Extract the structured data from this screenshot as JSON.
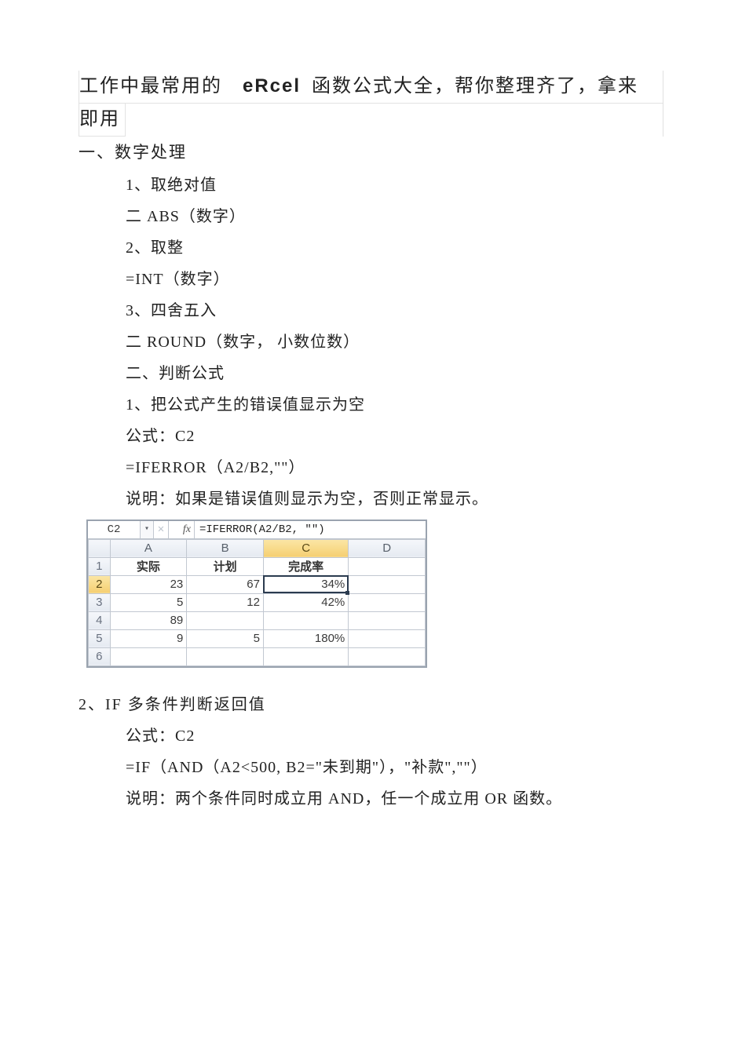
{
  "title": {
    "seg1": "工作中最常用的",
    "seg_eRcel": "eRcel",
    "seg2": "函数公式大全，帮你整理齐了，拿来",
    "line2": "即用"
  },
  "section1": {
    "heading": "一、数字处理",
    "lines": [
      "1、取绝对值",
      "二 ABS（数字）",
      "2、取整",
      "=INT（数字）",
      "3、四舍五入",
      "二 ROUND（数字， 小数位数）",
      "二、判断公式",
      "1、把公式产生的错误值显示为空",
      "公式：C2",
      "=IFERROR（A2/B2,\"\"）",
      "说明：如果是错误值则显示为空，否则正常显示。"
    ]
  },
  "excel": {
    "namebox": "C2",
    "fx_label": "fx",
    "formula": "=IFERROR(A2/B2, \"\")",
    "col_headers": [
      "A",
      "B",
      "C",
      "D"
    ],
    "row_numbers": [
      "1",
      "2",
      "3",
      "4",
      "5",
      "6"
    ],
    "header_row": [
      "实际",
      "计划",
      "完成率",
      ""
    ],
    "rows": [
      [
        "23",
        "67",
        "34%",
        ""
      ],
      [
        "5",
        "12",
        "42%",
        ""
      ],
      [
        "89",
        "",
        "",
        ""
      ],
      [
        "9",
        "5",
        "180%",
        ""
      ],
      [
        "",
        "",
        "",
        ""
      ]
    ],
    "selected_cell": {
      "row": 2,
      "col": "C"
    },
    "dropdown_glyph": "▾",
    "cancel_glyph": "✕"
  },
  "section2": {
    "heading": "2、IF 多条件判断返回值",
    "lines": [
      "公式：C2",
      "=IF（AND（A2<500, B2=\"未到期\"），\"补款\",\"\"）",
      "说明：两个条件同时成立用 AND，任一个成立用 OR 函数。"
    ]
  },
  "chart_data": {
    "type": "table",
    "title": "IFERROR 完成率示例",
    "columns": [
      "实际",
      "计划",
      "完成率"
    ],
    "rows": [
      {
        "实际": 23,
        "计划": 67,
        "完成率": "34%"
      },
      {
        "实际": 5,
        "计划": 12,
        "完成率": "42%"
      },
      {
        "实际": 89,
        "计划": null,
        "完成率": ""
      },
      {
        "实际": 9,
        "计划": 5,
        "完成率": "180%"
      }
    ],
    "formula_cell": "C2",
    "formula": "=IFERROR(A2/B2, \"\")"
  }
}
